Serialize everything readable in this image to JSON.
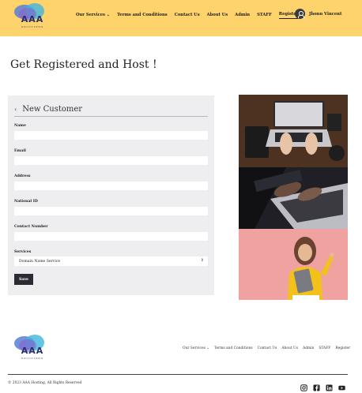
{
  "header": {
    "logo_text": "AAA",
    "logo_sub": "SOLUTIONS",
    "nav": [
      "Our Services ⌄",
      "Terms and Conditions",
      "Contact Us",
      "About Us",
      "Admin",
      "STAFF",
      "Register"
    ],
    "user_name": "Jhonn Vincent"
  },
  "page": {
    "title": "Get Registered and Host !"
  },
  "form": {
    "heading": "New Customer",
    "back_icon": "chevron-left-icon",
    "fields": [
      {
        "label": "Name",
        "value": ""
      },
      {
        "label": "Email",
        "value": ""
      },
      {
        "label": "Address",
        "value": ""
      },
      {
        "label": "National ID",
        "value": ""
      },
      {
        "label": "Contact Number",
        "value": ""
      }
    ],
    "services_label": "Services",
    "services_selected": "Domain Name Service",
    "save_label": "Save"
  },
  "images": [
    "laptop-desk-photo",
    "laptop-typing-photo",
    "woman-with-laptop-photo"
  ],
  "footer": {
    "logo_text": "AAA",
    "logo_sub": "SOLUTIONS",
    "nav": [
      "Our Services ⌄",
      "Terms and Conditions",
      "Contact Us",
      "About Us",
      "Admin",
      "STAFF",
      "Register"
    ],
    "copyright": "© 2023 AAA Hosting, All Rights Reserved",
    "social_icons": [
      "instagram-icon",
      "facebook-icon",
      "linkedin-icon",
      "youtube-icon"
    ]
  },
  "colors": {
    "header_bg": "#ffd36b",
    "panel_bg": "#eeeef1",
    "button_bg": "#2b2b36"
  }
}
